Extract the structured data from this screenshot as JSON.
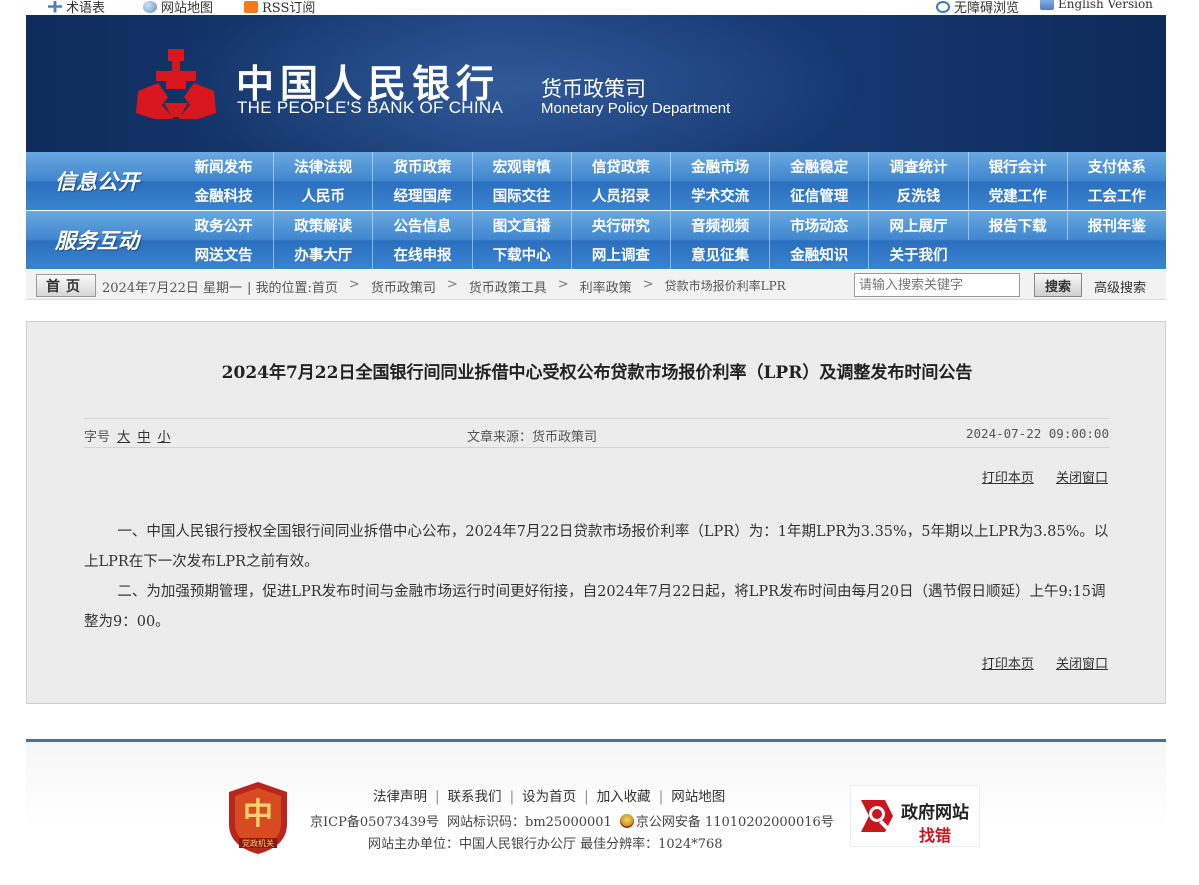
{
  "topbar": {
    "terms": "术语表",
    "sitemap": "网站地图",
    "rss": "RSS订阅",
    "accessible": "无障碍浏览",
    "english": "English Version"
  },
  "banner": {
    "cn_name": "中国人民银行",
    "en_name": "THE PEOPLE'S BANK OF CHINA",
    "dept_cn": "货币政策司",
    "dept_en": "Monetary Policy Department"
  },
  "nav": {
    "info": {
      "section": "信息公开",
      "items": [
        "新闻发布",
        "法律法规",
        "货币政策",
        "宏观审慎",
        "信贷政策",
        "金融市场",
        "金融稳定",
        "调查统计",
        "银行会计",
        "支付体系",
        "金融科技",
        "人民币",
        "经理国库",
        "国际交往",
        "人员招录",
        "学术交流",
        "征信管理",
        "反洗钱",
        "党建工作",
        "工会工作"
      ]
    },
    "service": {
      "section": "服务互动",
      "items": [
        "政务公开",
        "政策解读",
        "公告信息",
        "图文直播",
        "央行研究",
        "音频视频",
        "市场动态",
        "网上展厅",
        "报告下载",
        "报刊年鉴",
        "网送文告",
        "办事大厅",
        "在线申报",
        "下载中心",
        "网上调查",
        "意见征集",
        "金融知识",
        "关于我们"
      ]
    }
  },
  "crumbbar": {
    "home": "首页",
    "date": "2024年7月22日 星期一",
    "location_label": "| 我的位置:",
    "path": [
      "首页",
      "货币政策司",
      "货币政策工具",
      "利率政策",
      "贷款市场报价利率LPR"
    ],
    "search_placeholder": "请输入搜索关键字",
    "search_button": "搜索",
    "advanced": "高级搜索"
  },
  "article": {
    "title": "2024年7月22日全国银行间同业拆借中心受权公布贷款市场报价利率（LPR）及调整发布时间公告",
    "font_label": "字号",
    "font_large": "大",
    "font_medium": "中",
    "font_small": "小",
    "source": "文章来源：货币政策司",
    "datetime": "2024-07-22 09:00:00",
    "print": "打印本页",
    "close": "关闭窗口",
    "paragraphs": [
      "一、中国人民银行授权全国银行间同业拆借中心公布，2024年7月22日贷款市场报价利率（LPR）为：1年期LPR为3.35%，5年期以上LPR为3.85%。以上LPR在下一次发布LPR之前有效。",
      "二、为加强预期管理，促进LPR发布时间与金融市场运行时间更好衔接，自2024年7月22日起，将LPR发布时间由每月20日（遇节假日顺延）上午9:15调整为9：00。"
    ]
  },
  "footer": {
    "links": [
      "法律声明",
      "联系我们",
      "设为首页",
      "加入收藏",
      "网站地图"
    ],
    "icp": "京ICP备05073439号",
    "site_id": "网站标识码：bm25000001",
    "police": "京公网安备 11010202000016号",
    "host": "网站主办单位：中国人民银行办公厅   最佳分辨率：1024*768",
    "party_badge": "党政机关",
    "gov_badge_line1": "政府网站",
    "gov_badge_line2": "找错"
  },
  "colors": {
    "banner_bg": "#163872",
    "nav_blue": "#3f86cf",
    "logo_red": "#d7161e",
    "article_bg": "#ececec"
  }
}
